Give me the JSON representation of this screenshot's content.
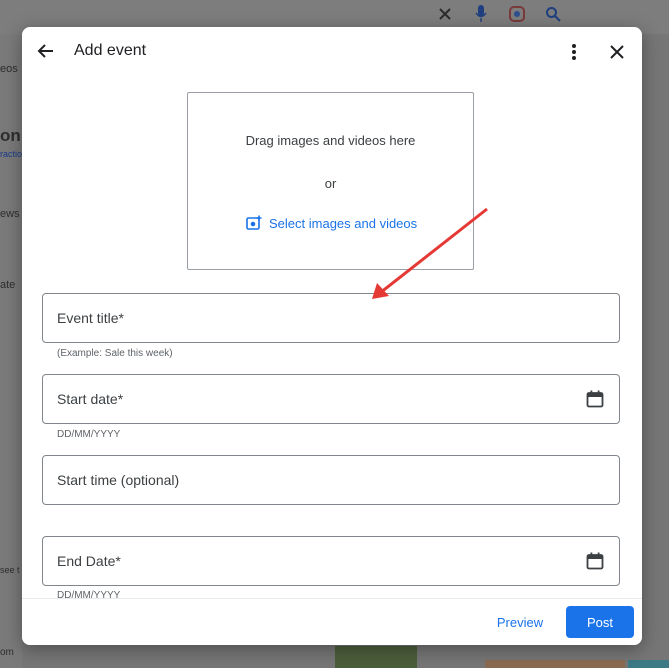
{
  "background": {
    "left_fragments": [
      "eos",
      "on",
      "ractio",
      "ews",
      "ate",
      "see t",
      "om"
    ]
  },
  "dialog": {
    "title": "Add event",
    "dropzone": {
      "drag_text": "Drag images and videos here",
      "or_text": "or",
      "select_label": "Select images and videos"
    },
    "fields": {
      "event_title": {
        "label": "Event title*",
        "helper": "(Example: Sale this week)"
      },
      "start_date": {
        "label": "Start date*",
        "helper": "DD/MM/YYYY"
      },
      "start_time": {
        "label": "Start time (optional)"
      },
      "end_date": {
        "label": "End Date*",
        "helper": "DD/MM/YYYY"
      }
    },
    "footer": {
      "preview_label": "Preview",
      "post_label": "Post"
    }
  },
  "colors": {
    "accent": "#1a73e8",
    "annotation_arrow": "#e53935",
    "overlay": "#767676"
  },
  "icons": [
    "back-arrow-icon",
    "more-vert-icon",
    "close-icon",
    "add-photo-icon",
    "calendar-icon",
    "mic-icon",
    "lens-icon",
    "search-icon"
  ]
}
